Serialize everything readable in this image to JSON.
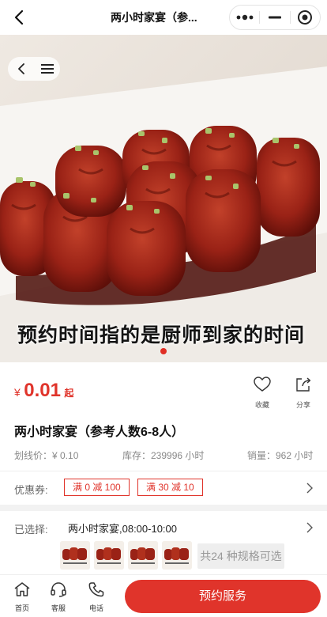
{
  "header": {
    "title": "两小时家宴（参...",
    "icons": [
      "back-arrow-icon",
      "more-dots-icon",
      "minimize-icon",
      "close-circle-icon"
    ]
  },
  "hero": {
    "caption": "预约时间指的是厨师到家的时间",
    "float_icons": [
      "back-arrow-icon",
      "menu-icon"
    ],
    "indicator_count": 1,
    "indicator_active": 0
  },
  "product": {
    "currency": "¥",
    "price": "0.01",
    "price_suffix": "起",
    "title": "两小时家宴（参考人数6-8人）",
    "original_price": "划线价：¥ 0.10",
    "stock": "库存：239996 小时",
    "sales": "销量：962 小时"
  },
  "actions": {
    "favorite": "收藏",
    "share": "分享"
  },
  "coupons": {
    "label": "优惠券:",
    "items": [
      "满 0 减 100",
      "满 30 减 10"
    ]
  },
  "spec": {
    "label": "已选择:",
    "value": "两小时家宴,08:00-10:00",
    "thumbnail_count": 4,
    "more": "共24 种规格可选"
  },
  "bottom_nav": {
    "items": [
      {
        "label": "首页",
        "icon": "home-icon"
      },
      {
        "label": "客服",
        "icon": "headset-icon"
      },
      {
        "label": "电话",
        "icon": "phone-icon"
      }
    ],
    "cta": "预约服务"
  },
  "colors": {
    "accent": "#e0342b",
    "price": "#e0342b"
  }
}
